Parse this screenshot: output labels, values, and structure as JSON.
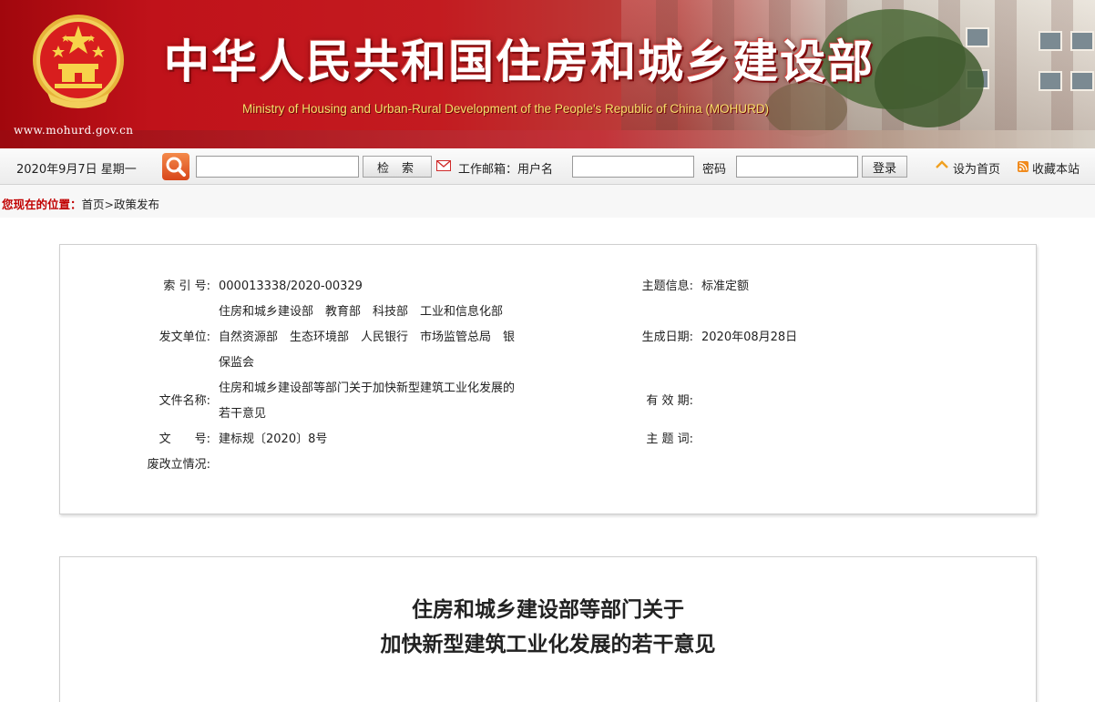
{
  "header": {
    "title_cn": "中华人民共和国住房和城乡建设部",
    "title_en": "Ministry of Housing and Urban-Rural Development of the People's Republic of China (MOHURD)",
    "site_url": "www.mohurd.gov.cn",
    "emblem_icon": "national-emblem-icon"
  },
  "toolbar": {
    "date": "2020年9月7日 星期一",
    "search_button": "检索",
    "search_value": "",
    "mail_label": "工作邮箱：用户名",
    "username_value": "",
    "password_label": "密码",
    "password_value": "",
    "login_button": "登录",
    "set_home": "设为首页",
    "bookmark": "收藏本站"
  },
  "breadcrumb": {
    "label": "您现在的位置：",
    "home": "首页",
    "separator": ">",
    "current": "政策发布"
  },
  "info": {
    "index_label": "索 引 号:",
    "index_value": "000013338/2020-00329",
    "topic_label": "主题信息:",
    "topic_value": "标准定额",
    "issuer_label": "发文单位:",
    "issuer_line1": "住房和城乡建设部　教育部　科技部　工业和信息化部",
    "issuer_line2": "自然资源部　生态环境部　人民银行　市场监管总局　银",
    "issuer_line3": "保监会",
    "date_label": "生成日期:",
    "date_value": "2020年08月28日",
    "name_label": "文件名称:",
    "name_line1": "住房和城乡建设部等部门关于加快新型建筑工业化发展的",
    "name_line2": "若干意见",
    "valid_label": "有 效 期:",
    "valid_value": "",
    "docno_label": "文　　号:",
    "docno_value": "建标规〔2020〕8号",
    "keyword_label": "主 题 词:",
    "keyword_value": "",
    "status_label": "废改立情况:",
    "status_value": ""
  },
  "article": {
    "title_line1": "住房和城乡建设部等部门关于",
    "title_line2": "加快新型建筑工业化发展的若干意见"
  },
  "colors": {
    "banner_red": "#c0121a",
    "title_yellow": "#f6e06a",
    "breadcrumb_red": "#c10000"
  }
}
